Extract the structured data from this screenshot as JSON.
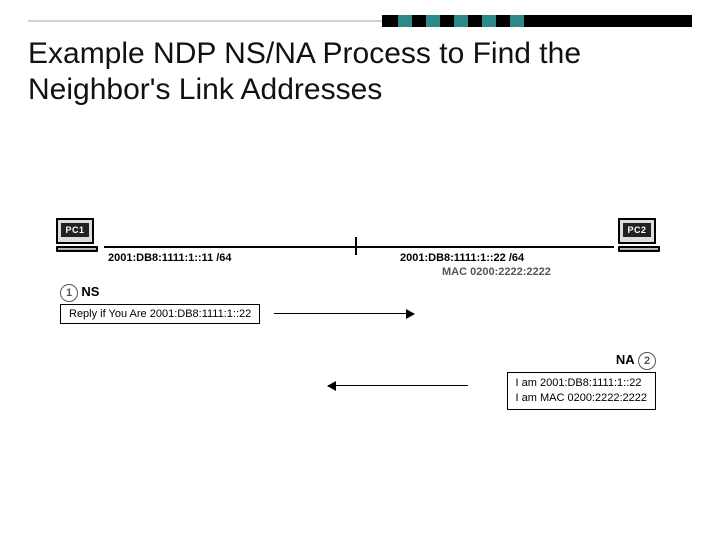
{
  "title": "Example NDP NS/NA Process to Find the Neighbor's Link Addresses",
  "pc1": {
    "label": "PC1",
    "address": "2001:DB8:1111:1::11 /64"
  },
  "pc2": {
    "label": "PC2",
    "address": "2001:DB8:1111:1::22 /64",
    "mac": "MAC 0200:2222:2222"
  },
  "steps": {
    "ns": {
      "num": "1",
      "label": "NS",
      "message": "Reply if You Are 2001:DB8:1111:1::22"
    },
    "na": {
      "num": "2",
      "label": "NA",
      "line1": "I am 2001:DB8:1111:1::22",
      "line2": "I am MAC 0200:2222:2222"
    }
  }
}
